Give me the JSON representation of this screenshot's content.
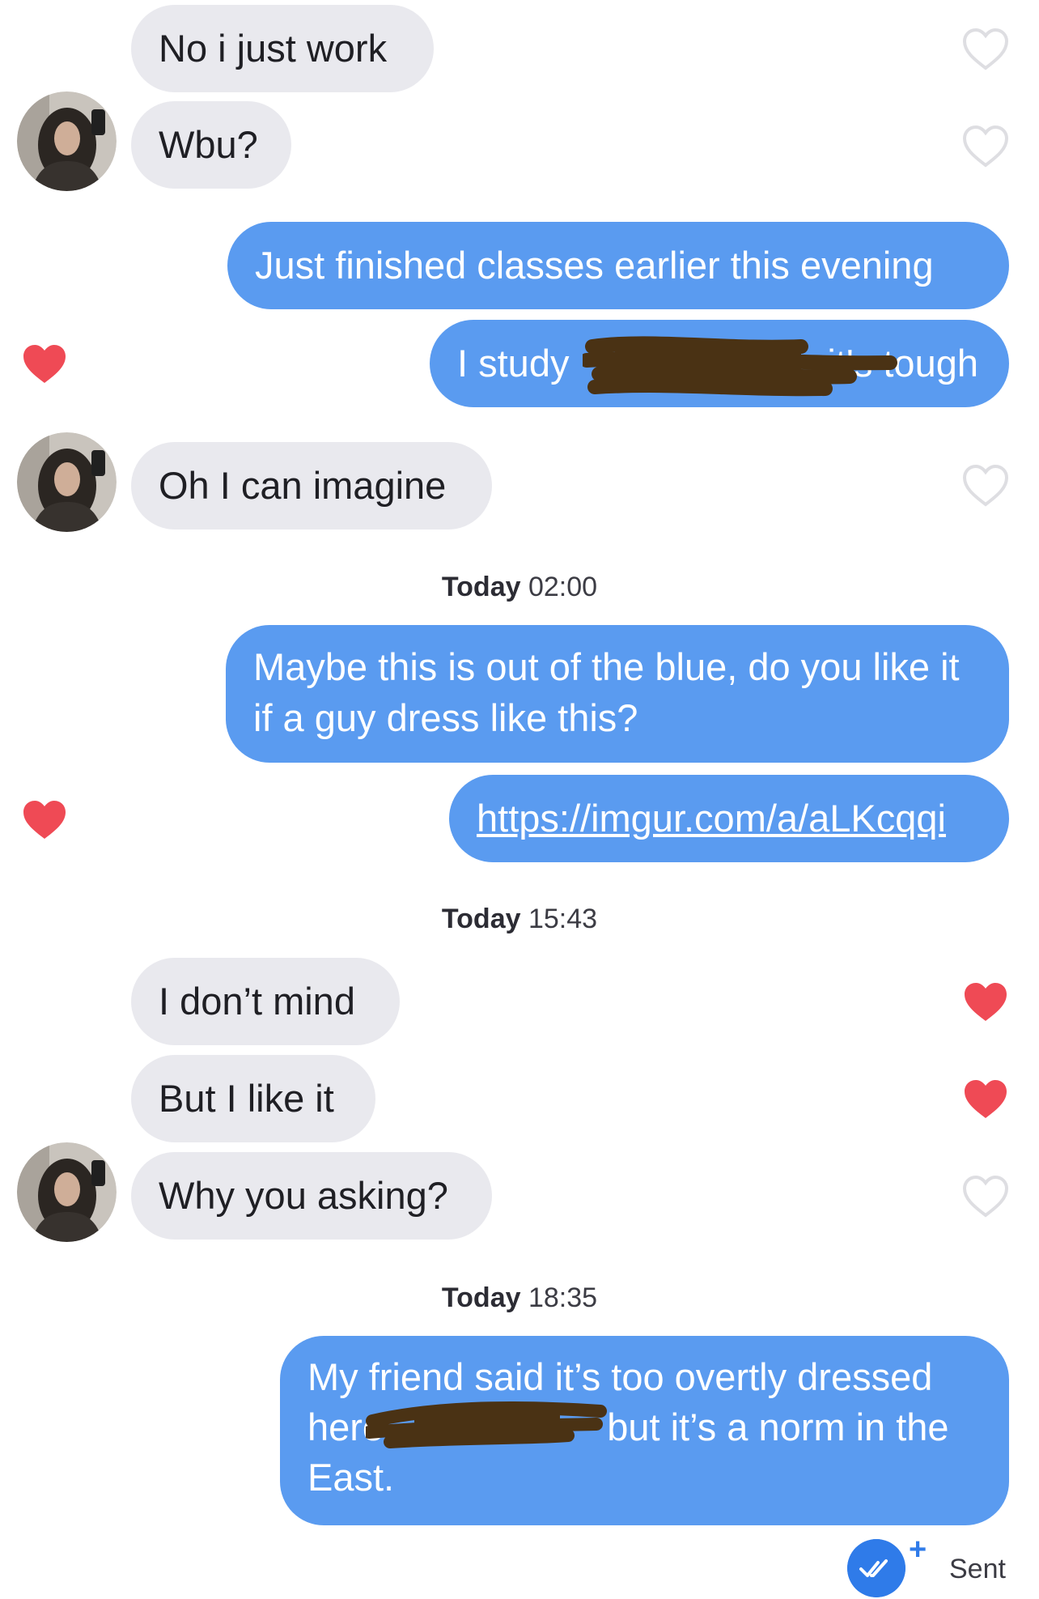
{
  "colors": {
    "incoming_bubble": "#e9e9ee",
    "outgoing_bubble": "#5a9bf0",
    "heart_liked": "#ef4a55",
    "heart_outline": "#dedee2",
    "sent_accent": "#2f7be9"
  },
  "messages": [
    {
      "text": "No i just work"
    },
    {
      "text": "Wbu?"
    },
    {
      "text": "Just finished classes earlier this evening"
    },
    {
      "text": "I study",
      "text_end": "it's tough"
    },
    {
      "text": "Oh I can imagine"
    },
    {
      "text": "Maybe this is out of the blue, do you like it if a guy dress like this?"
    },
    {
      "text": "https://imgur.com/a/aLKcqqi"
    },
    {
      "text": "I don’t mind"
    },
    {
      "text": "But I like it"
    },
    {
      "text": "Why you asking?"
    },
    {
      "text": "My friend said it’s too overtly dressed here",
      "text_end": "but it’s a norm in the East."
    }
  ],
  "timestamps": [
    {
      "day": "Today",
      "time": "02:00"
    },
    {
      "day": "Today",
      "time": "15:43"
    },
    {
      "day": "Today",
      "time": "18:35"
    }
  ],
  "likes": {
    "m1": "heart-outline-icon",
    "m2": "heart-outline-icon",
    "m4": "heart-filled-icon",
    "m5": "heart-outline-icon",
    "m7": "heart-filled-icon",
    "m8": "heart-filled-icon",
    "m9": "heart-filled-icon",
    "m10": "heart-outline-icon"
  },
  "status": {
    "icon": "double-check-icon",
    "plus": "+",
    "label": "Sent"
  }
}
